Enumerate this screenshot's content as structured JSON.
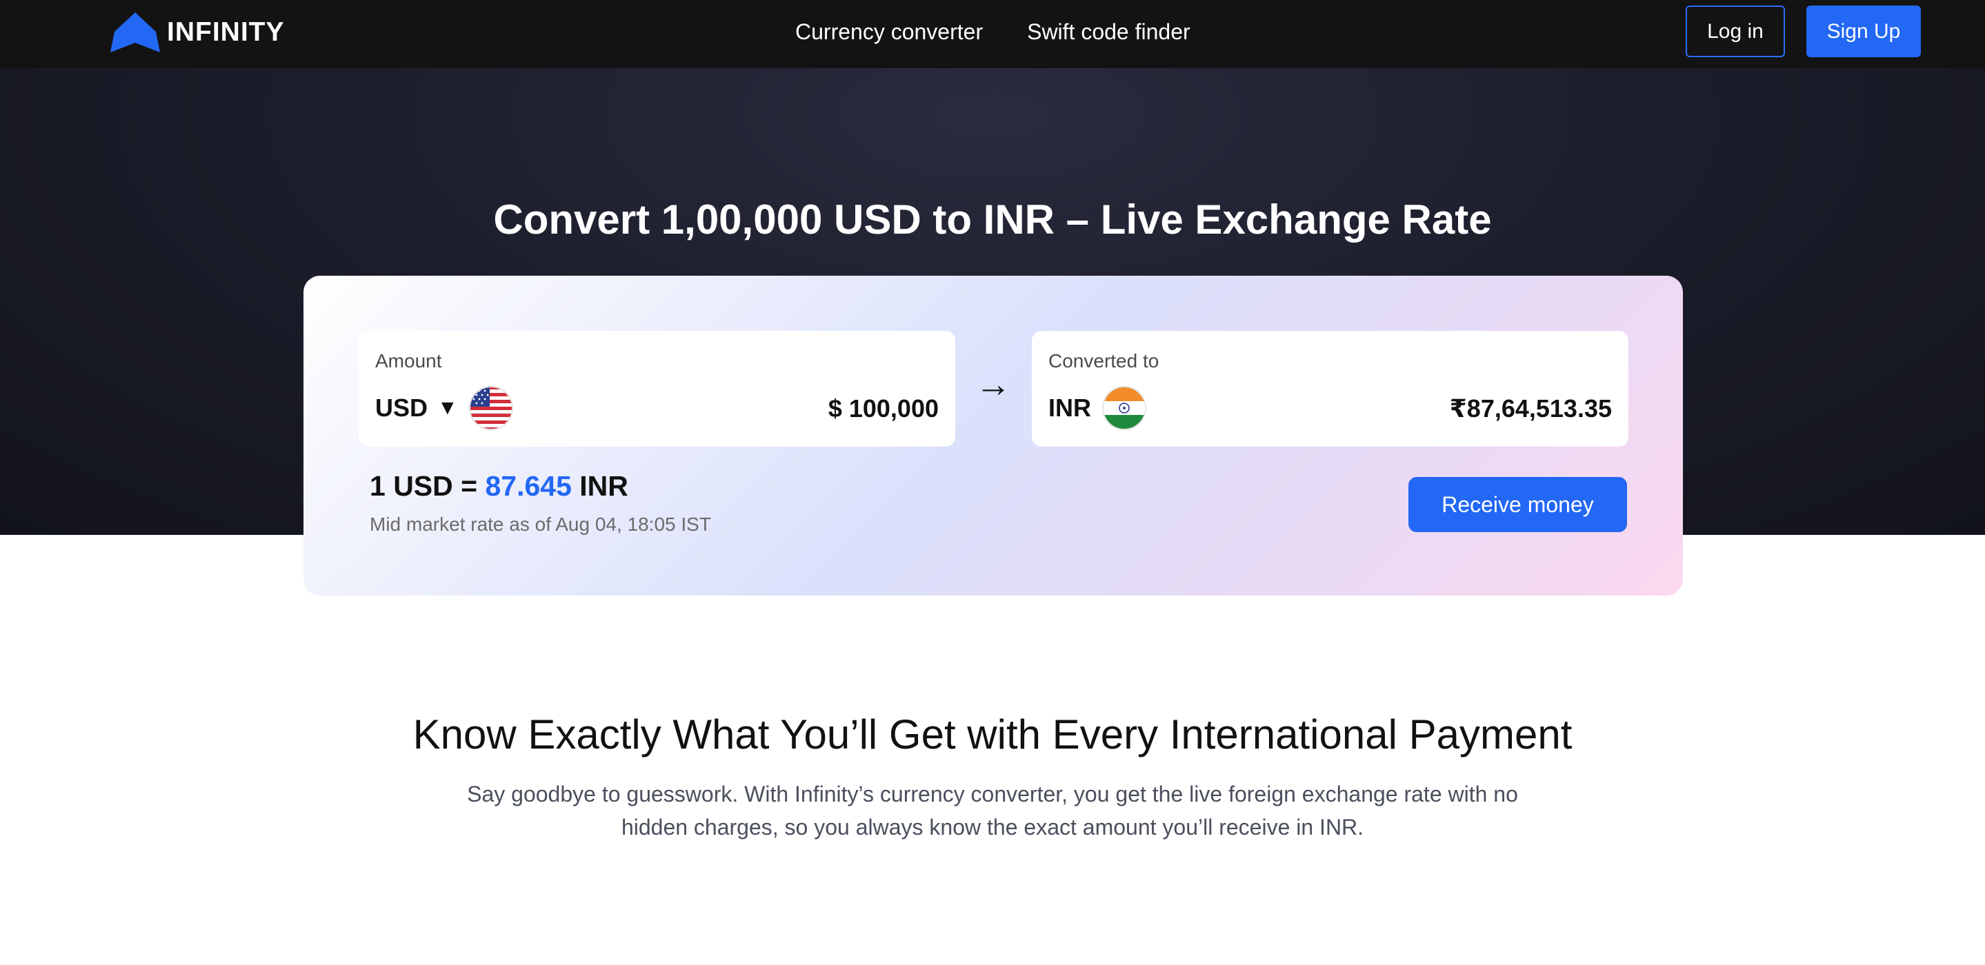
{
  "brand": {
    "name": "INFINITY",
    "color": "#2368f4"
  },
  "nav": {
    "links": [
      "Currency converter",
      "Swift code finder"
    ],
    "login_label": "Log in",
    "signup_label": "Sign Up"
  },
  "hero": {
    "title": "Convert 1,00,000 USD to INR – Live Exchange Rate"
  },
  "converter": {
    "from": {
      "label": "Amount",
      "currency": "USD",
      "caret": "▼",
      "flag_icon": "us-flag-icon",
      "value": "$ 100,000"
    },
    "arrow": "→",
    "to": {
      "label": "Converted to",
      "currency": "INR",
      "flag_icon": "india-flag-icon",
      "value": "₹87,64,513.35"
    },
    "rate": {
      "prefix": "1 USD = ",
      "value": "87.645",
      "suffix": " INR",
      "note": "Mid market rate as of Aug 04, 18:05 IST"
    },
    "receive_label": "Receive money"
  },
  "info": {
    "title": "Know Exactly What You’ll Get with Every International Payment",
    "text": "Say goodbye to guesswork. With Infinity’s currency converter, you get the live foreign exchange rate with no hidden charges, so you always know the exact amount you’ll receive in INR."
  },
  "colors": {
    "nav_bg": "#131313",
    "primary": "#2368f4",
    "hero_bg": "#1c1e2c"
  }
}
